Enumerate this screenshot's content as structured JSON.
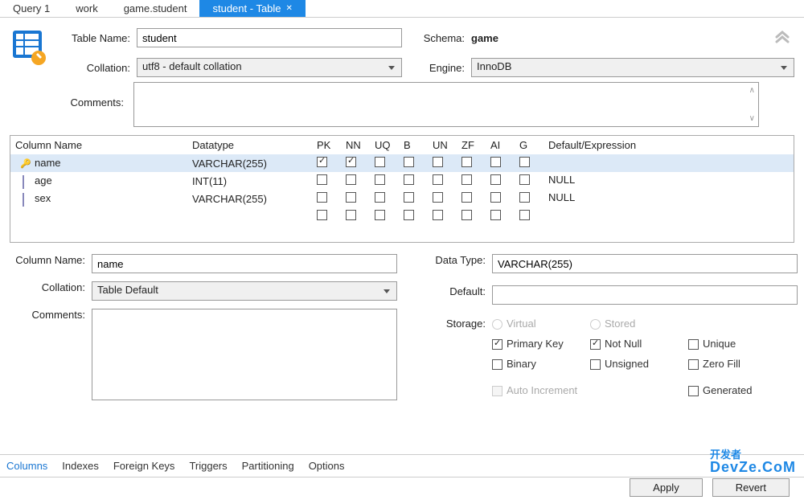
{
  "tabs": {
    "items": [
      "Query 1",
      "work",
      "game.student",
      "student - Table"
    ],
    "activeIndex": 3
  },
  "header": {
    "tableNameLabel": "Table Name:",
    "tableName": "student",
    "schemaLabel": "Schema:",
    "schema": "game",
    "collationLabel": "Collation:",
    "collation": "utf8 - default collation",
    "engineLabel": "Engine:",
    "engine": "InnoDB",
    "commentsLabel": "Comments:",
    "comments": ""
  },
  "grid": {
    "headers": [
      "Column Name",
      "Datatype",
      "PK",
      "NN",
      "UQ",
      "B",
      "UN",
      "ZF",
      "AI",
      "G",
      "Default/Expression"
    ],
    "rows": [
      {
        "name": "name",
        "datatype": "VARCHAR(255)",
        "pk": true,
        "nn": true,
        "uq": false,
        "b": false,
        "un": false,
        "zf": false,
        "ai": false,
        "g": false,
        "default": "",
        "selected": true,
        "icon": "key"
      },
      {
        "name": "age",
        "datatype": "INT(11)",
        "pk": false,
        "nn": false,
        "uq": false,
        "b": false,
        "un": false,
        "zf": false,
        "ai": false,
        "g": false,
        "default": "NULL",
        "selected": false,
        "icon": "diamond"
      },
      {
        "name": "sex",
        "datatype": "VARCHAR(255)",
        "pk": false,
        "nn": false,
        "uq": false,
        "b": false,
        "un": false,
        "zf": false,
        "ai": false,
        "g": false,
        "default": "NULL",
        "selected": false,
        "icon": "diamond"
      }
    ]
  },
  "detail": {
    "columnNameLabel": "Column Name:",
    "columnName": "name",
    "collationLabel": "Collation:",
    "collation": "Table Default",
    "commentsLabel": "Comments:",
    "comments": "",
    "dataTypeLabel": "Data Type:",
    "dataType": "VARCHAR(255)",
    "defaultLabel": "Default:",
    "default": "",
    "storageLabel": "Storage:",
    "options": {
      "virtual": "Virtual",
      "stored": "Stored",
      "primaryKey": "Primary Key",
      "notNull": "Not Null",
      "unique": "Unique",
      "binary": "Binary",
      "unsigned": "Unsigned",
      "zeroFill": "Zero Fill",
      "autoIncrement": "Auto Increment",
      "generated": "Generated"
    },
    "state": {
      "primaryKey": true,
      "notNull": true,
      "unique": false,
      "binary": false,
      "unsigned": false,
      "zeroFill": false,
      "autoIncrement": false,
      "generated": false
    }
  },
  "bottomTabs": {
    "items": [
      "Columns",
      "Indexes",
      "Foreign Keys",
      "Triggers",
      "Partitioning",
      "Options"
    ],
    "activeIndex": 0
  },
  "footer": {
    "apply": "Apply",
    "revert": "Revert"
  },
  "watermark": {
    "line1": "开发者",
    "line2": "DevZe.CoM"
  }
}
